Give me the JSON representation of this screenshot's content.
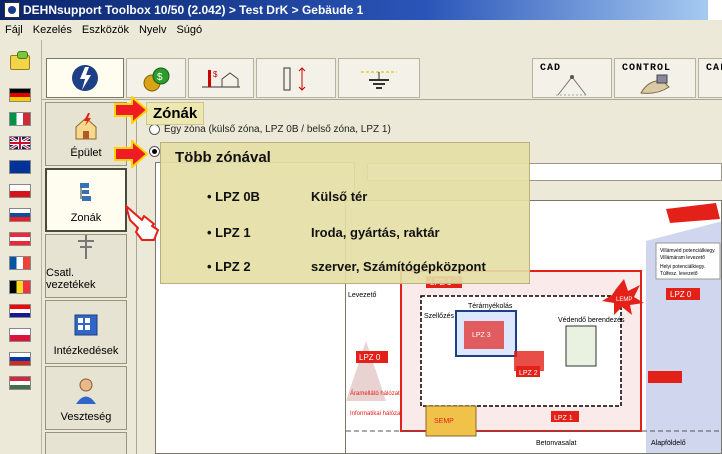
{
  "window": {
    "title": "DEHNsupport Toolbox 10/50 (2.042) > Test DrK > Gebäude 1"
  },
  "menu": [
    "Fájl",
    "Kezelés",
    "Eszközök",
    "Nyelv",
    "Súgó"
  ],
  "toolbar": {
    "right_labels": [
      "CAD",
      "CONTROL",
      "CALC"
    ]
  },
  "sidebar": {
    "items": [
      {
        "label": "Épület",
        "icon": "house-lightning-icon",
        "active": false
      },
      {
        "label": "Zonák",
        "icon": "zones-icon",
        "active": true
      },
      {
        "label": "Csatl. vezetékek",
        "icon": "power-line-icon",
        "active": false
      },
      {
        "label": "Intézkedések",
        "icon": "calculator-grid-icon",
        "active": false
      },
      {
        "label": "Veszteség",
        "icon": "person-icon",
        "active": false
      }
    ]
  },
  "zones": {
    "option1": "Egy zóna (külső zóna, LPZ 0B / belső zóna, LPZ 1)"
  },
  "overlay": {
    "zonak_label": "Zónák",
    "title": "Több zónával",
    "rows": [
      {
        "lpz": "• LPZ 0B",
        "desc": "Külső tér"
      },
      {
        "lpz": "• LPZ 1",
        "desc": "Iroda, gyártás, raktár"
      },
      {
        "lpz": "• LPZ 2",
        "desc": "szerver, Számítógépközpont"
      }
    ]
  },
  "diagram": {
    "legend": [
      "Villámvéd potenciálkiegy.",
      "Villámáram levezető",
      "Helyi potenciálkiegy.",
      "Túlfesz. levezető"
    ],
    "labels": {
      "levezeto": "Levezető",
      "szellozes": "Szellőzés",
      "teramyekolas": "Térárnyékolás",
      "vedendo": "Védendő berendezés",
      "lemp": "LEMP",
      "semp": "SEMP",
      "lpz1": "LPZ 1",
      "lpz2": "LPZ 2",
      "lpz3": "LPZ 3",
      "lpz0a": "LPZ 0",
      "lpz0b": "LPZ 0",
      "aramellato": "Áramellátó hálózat",
      "informatikai": "Informatikai hálózat",
      "betonvasalat": "Betonvasalat",
      "alapfoldelo": "Alapföldelő"
    }
  },
  "colors": {
    "accent_red": "#e32119",
    "overlay_bg": "#e4dea6",
    "arrow_red": "#ee1c24",
    "arrow_yellow": "#ffd400"
  }
}
